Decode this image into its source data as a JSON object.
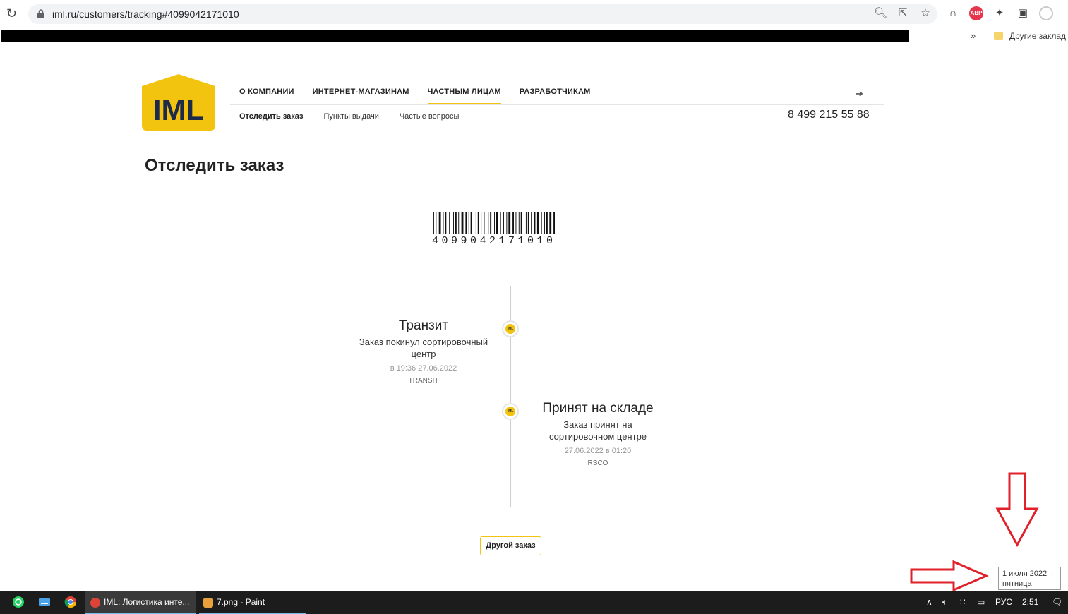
{
  "browser": {
    "url": "iml.ru/customers/tracking#4099042171010",
    "other_bookmarks": "Другие заклад",
    "bookmarks_more": "»"
  },
  "site": {
    "logo_text": "IML",
    "nav": {
      "items": [
        "О КОМПАНИИ",
        "ИНТЕРНЕТ-МАГАЗИНАМ",
        "ЧАСТНЫМ ЛИЦАМ",
        "РАЗРАБОТЧИКАМ"
      ],
      "active_index": 2,
      "sub_items": [
        "Отследить заказ",
        "Пункты выдачи",
        "Частые вопросы"
      ],
      "phone": "8 499 215 55 88"
    },
    "page_title": "Отследить заказ",
    "tracking_number": "4099042171010",
    "events": [
      {
        "title": "Транзит",
        "description_line1": "Заказ покинул сортировочный",
        "description_line2": "центр",
        "time": "в 19:36 27.06.2022",
        "code": "TRANSIT"
      },
      {
        "title": "Принят на складе",
        "description_line1": "Заказ принят на",
        "description_line2": "сортировочном центре",
        "time": "27.06.2022 в 01:20",
        "code": "RSCO"
      }
    ],
    "other_order_button": "Другой заказ"
  },
  "tooltip": {
    "line1": "1 июля 2022 г.",
    "line2": "пятница"
  },
  "taskbar": {
    "task1": "IML: Логистика инте...",
    "task2": "7.png - Paint",
    "language": "РУС",
    "clock": "2:51"
  },
  "colors": {
    "brand_yellow": "#f2c40f",
    "annotation_red": "#e0212b"
  }
}
